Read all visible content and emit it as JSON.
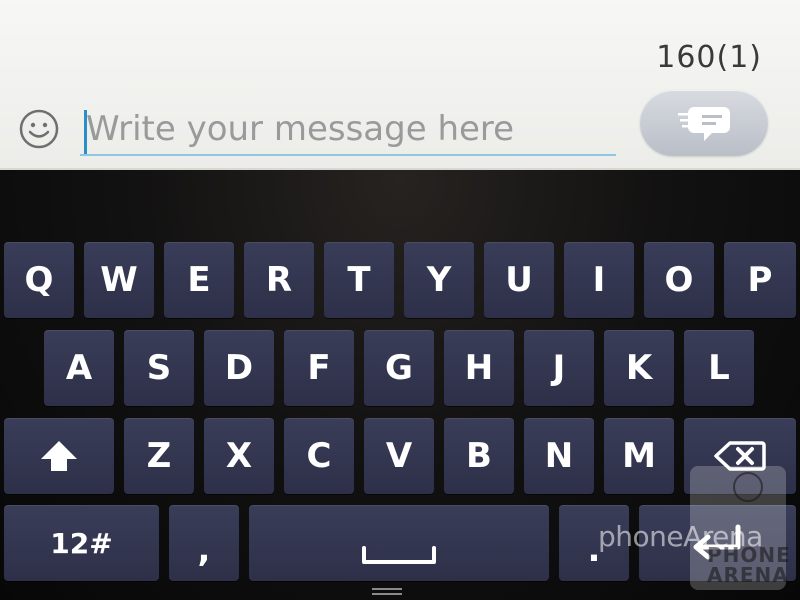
{
  "compose": {
    "char_counter": "160(1)",
    "placeholder": "Write your message here",
    "emoticon_icon": "smiley-face-icon",
    "send_icon": "send-message-icon"
  },
  "keyboard": {
    "row1": [
      "Q",
      "W",
      "E",
      "R",
      "T",
      "Y",
      "U",
      "I",
      "O",
      "P"
    ],
    "row2": [
      "A",
      "S",
      "D",
      "F",
      "G",
      "H",
      "J",
      "K",
      "L"
    ],
    "row3": [
      "Z",
      "X",
      "C",
      "V",
      "B",
      "N",
      "M"
    ],
    "shift_icon": "shift-arrow-icon",
    "backspace_icon": "backspace-icon",
    "symbols_label": "12#",
    "comma_label": ",",
    "space_icon": "space-bar-icon",
    "period_label": ".",
    "enter_icon": "enter-arrow-icon"
  },
  "nav": {
    "handle_icon": "menu-handle-icon"
  },
  "watermark": {
    "text": "phoneArena",
    "logo_line1": "PHONE",
    "logo_line2": "ARENA"
  },
  "colors": {
    "key_background": "#33354f",
    "key_text": "#ffffff",
    "compose_background": "#f2f2f0",
    "input_underline": "#8ec7e0",
    "caret": "#2a8fc9"
  }
}
